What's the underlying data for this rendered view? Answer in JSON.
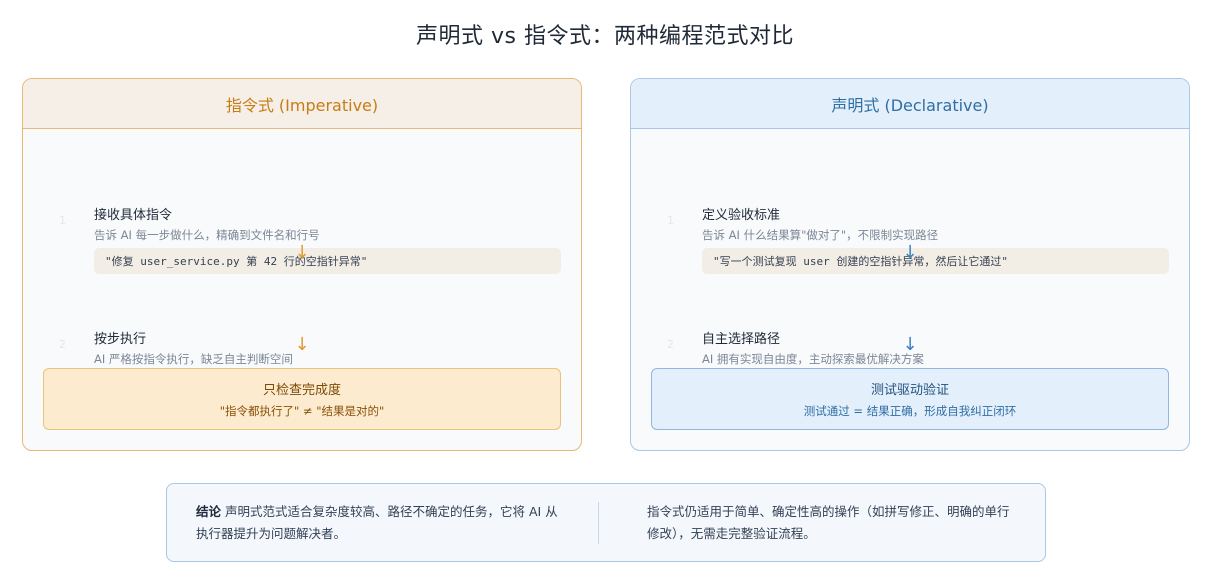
{
  "title": "声明式 vs 指令式：两种编程范式对比",
  "imperative": {
    "header": "指令式 (Imperative)",
    "steps": [
      {
        "num": "1",
        "title": "接收具体指令",
        "desc": "告诉 AI 每一步做什么，精确到文件名和行号",
        "code": "\"修复 user_service.py 第 42 行的空指针异常\""
      },
      {
        "num": "2",
        "title": "按步执行",
        "desc": "AI 严格按指令执行，缺乏自主判断空间"
      }
    ],
    "arrow": "↓",
    "result": {
      "title": "只检查完成度",
      "sub": "\"指令都执行了\" ≠ \"结果是对的\""
    }
  },
  "declarative": {
    "header": "声明式 (Declarative)",
    "steps": [
      {
        "num": "1",
        "title": "定义验收标准",
        "desc": "告诉 AI 什么结果算\"做对了\"，不限制实现路径",
        "code": "\"写一个测试复现 user 创建的空指针异常，然后让它通过\""
      },
      {
        "num": "2",
        "title": "自主选择路径",
        "desc": "AI 拥有实现自由度，主动探索最优解决方案"
      }
    ],
    "arrow": "↓",
    "result": {
      "title": "测试驱动验证",
      "sub": "测试通过 = 结果正确，形成自我纠正闭环"
    }
  },
  "summary": {
    "label": "结论",
    "left": "声明式范式适合复杂度较高、路径不确定的任务，它将 AI 从执行器提升为问题解决者。",
    "right": "指令式仍适用于简单、确定性高的操作（如拼写修正、明确的单行修改），无需走完整验证流程。"
  }
}
